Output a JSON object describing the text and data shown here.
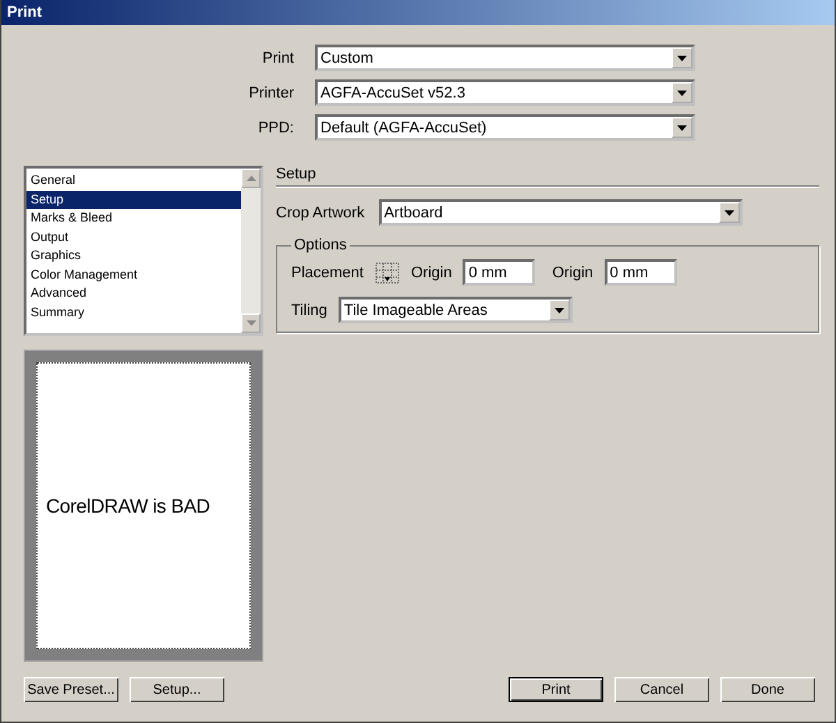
{
  "window": {
    "title": "Print"
  },
  "top_fields": [
    {
      "label": "Print",
      "value": "Custom"
    },
    {
      "label": "Printer",
      "value": "AGFA-AccuSet v52.3"
    },
    {
      "label": "PPD:",
      "value": "Default (AGFA-AccuSet)"
    }
  ],
  "categories": [
    {
      "label": "General",
      "selected": false
    },
    {
      "label": "Setup",
      "selected": true
    },
    {
      "label": "Marks & Bleed",
      "selected": false
    },
    {
      "label": "Output",
      "selected": false
    },
    {
      "label": "Graphics",
      "selected": false
    },
    {
      "label": "Color Management",
      "selected": false
    },
    {
      "label": "Advanced",
      "selected": false
    },
    {
      "label": "Summary",
      "selected": false
    }
  ],
  "preview": {
    "text": "CorelDRAW is BAD"
  },
  "setup": {
    "heading": "Setup",
    "crop_label": "Crop Artwork",
    "crop_value": "Artboard",
    "options": {
      "title": "Options",
      "placement_label": "Placement",
      "origin_x_label": "Origin",
      "origin_x_value": "0 mm",
      "origin_y_label": "Origin",
      "origin_y_value": "0 mm",
      "tiling_label": "Tiling",
      "tiling_value": "Tile Imageable Areas"
    }
  },
  "buttons_left": [
    "Save Preset...",
    "Setup..."
  ],
  "buttons_right": [
    {
      "label": "Print",
      "default": true
    },
    {
      "label": "Cancel",
      "default": false
    },
    {
      "label": "Done",
      "default": false
    }
  ]
}
